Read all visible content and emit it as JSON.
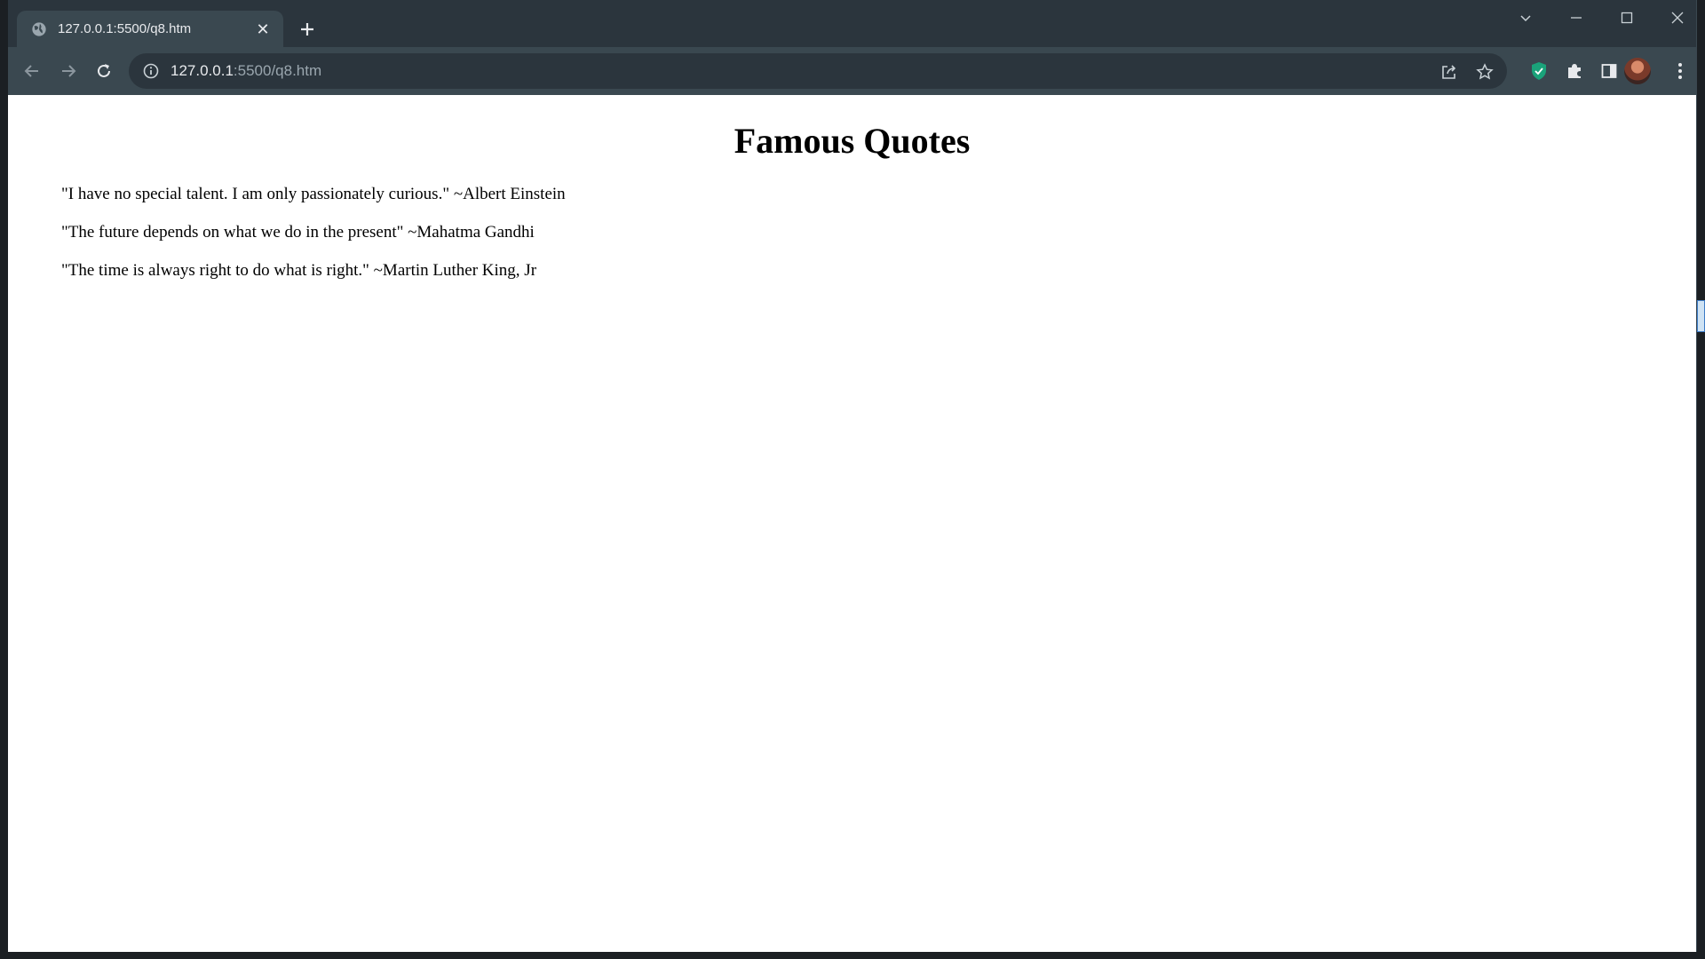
{
  "browser": {
    "tab": {
      "title": "127.0.0.1:5500/q8.htm",
      "close_glyph": "✕",
      "icon": "globe-icon"
    },
    "new_tab_icon": "plus-icon",
    "window_controls": [
      "chevron-down-icon",
      "minimize-icon",
      "maximize-icon",
      "close-icon"
    ],
    "address": {
      "host": "127.0.0.1",
      "path": ":5500/q8.htm",
      "value": "127.0.0.1:5500/q8.htm"
    },
    "toolbar_icons": [
      "back-icon",
      "forward-icon",
      "reload-icon",
      "site-info-icon",
      "share-icon",
      "bookmark-star-icon"
    ],
    "extensions": [
      "shield-extension-icon",
      "puzzle-extensions-icon",
      "side-panel-icon",
      "profile-avatar",
      "kebab-menu-icon"
    ],
    "colors": {
      "frame": "#2b353d",
      "toolbar": "#3a4850",
      "text": "#e8eaed",
      "shield": "#1aa37a"
    }
  },
  "page": {
    "heading": "Famous Quotes",
    "quotes": [
      "\"I have no special talent. I am only passionately curious.\" ~Albert Einstein",
      "\"The future depends on what we do in the present\" ~Mahatma Gandhi",
      "\"The time is always right to do what is right.\" ~Martin Luther King, Jr"
    ]
  }
}
